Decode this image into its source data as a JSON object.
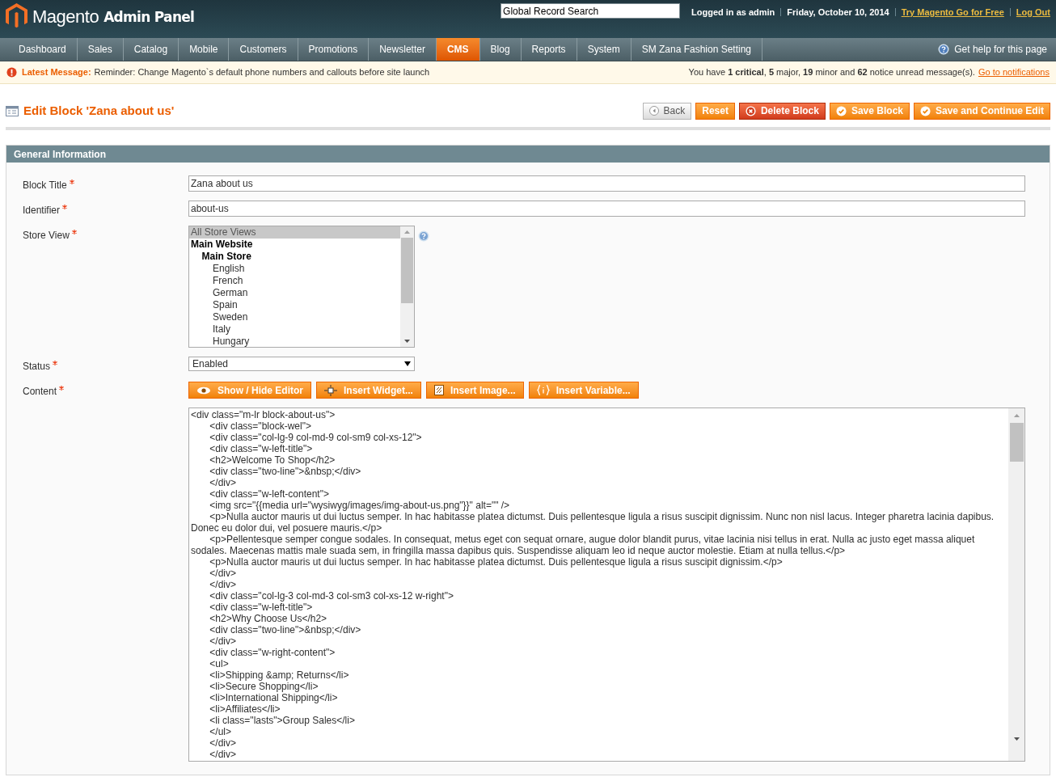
{
  "header": {
    "logo_text": "Magento",
    "logo_sub": "Admin Panel",
    "search": {
      "value": "Global Record Search"
    },
    "logged_in": "Logged in as admin",
    "date": "Friday, October 10, 2014",
    "links": [
      "Try Magento Go for Free",
      "Log Out"
    ]
  },
  "nav": {
    "items": [
      {
        "label": "Dashboard",
        "selected": false
      },
      {
        "label": "Sales",
        "selected": false
      },
      {
        "label": "Catalog",
        "selected": false
      },
      {
        "label": "Mobile",
        "selected": false
      },
      {
        "label": "Customers",
        "selected": false
      },
      {
        "label": "Promotions",
        "selected": false
      },
      {
        "label": "Newsletter",
        "selected": false
      },
      {
        "label": "CMS",
        "selected": true
      },
      {
        "label": "Blog",
        "selected": false
      },
      {
        "label": "Reports",
        "selected": false
      },
      {
        "label": "System",
        "selected": false
      },
      {
        "label": "SM Zana Fashion Setting",
        "selected": false
      }
    ],
    "help": "Get help for this page"
  },
  "message": {
    "label": "Latest Message:",
    "text": "Reminder: Change Magento`s default phone numbers and callouts before site launch",
    "summary": "You have **1 critical**, **5** major, **19** minor and **62** notice unread message(s).",
    "link": "Go to notifications"
  },
  "page": {
    "title": "Edit Block 'Zana about us'",
    "buttons": [
      {
        "label": "Back",
        "kind": "back"
      },
      {
        "label": "Reset",
        "kind": "plain"
      },
      {
        "label": "Delete Block",
        "kind": "delete"
      },
      {
        "label": "Save Block",
        "kind": "save"
      },
      {
        "label": "Save and Continue Edit",
        "kind": "save"
      }
    ]
  },
  "section": {
    "title": "General Information",
    "fields": [
      {
        "kind": "text",
        "label": "Block Title",
        "required": true,
        "value": "Zana about us"
      },
      {
        "kind": "text",
        "label": "Identifier",
        "required": true,
        "value": "about-us"
      },
      {
        "kind": "multiselect",
        "label": "Store View",
        "required": true,
        "options": [
          {
            "label": "All Store Views",
            "selected": true
          },
          {
            "label": "Main Website",
            "selected": false,
            "children": [
              {
                "label": "Main Store",
                "selected": false,
                "children": [
                  {
                    "label": "English",
                    "selected": false
                  },
                  {
                    "label": "French",
                    "selected": false
                  },
                  {
                    "label": "German",
                    "selected": false
                  },
                  {
                    "label": "Spain",
                    "selected": false
                  },
                  {
                    "label": "Sweden",
                    "selected": false
                  },
                  {
                    "label": "Italy",
                    "selected": false
                  },
                  {
                    "label": "Hungary",
                    "selected": false
                  }
                ]
              }
            ]
          }
        ]
      },
      {
        "kind": "select",
        "label": "Status",
        "required": true,
        "value": "Enabled"
      },
      {
        "kind": "editor",
        "label": "Content",
        "required": true,
        "buttons": [
          {
            "label": "Show / Hide Editor",
            "kind": "eye"
          },
          {
            "label": "Insert Widget...",
            "kind": "widget"
          },
          {
            "label": "Insert Image...",
            "kind": "image"
          },
          {
            "label": "Insert Variable...",
            "kind": "variable"
          }
        ],
        "lines": [
          "<div class=\"m-lr block-about-us\">",
          "\t<div class=\"block-wel\">",
          "\t<div class=\"col-lg-9 col-md-9 col-sm9 col-xs-12\">",
          "\t<div class=\"w-left-title\">",
          "\t<h2>Welcome To Shop</h2>",
          "\t<div class=\"two-line\">&nbsp;</div>",
          "\t</div>",
          "\t<div class=\"w-left-content\">",
          "\t<img src=\"{{media url=\"wysiwyg/images/img-about-us.png\"}}\" alt=\"\" />",
          "\t<p>Nulla auctor mauris ut dui luctus semper. In hac habitasse platea dictumst. Duis pellentesque ligula a risus suscipit dignissim. Nunc non nisl lacus. Integer pharetra lacinia dapibus. Donec eu dolor dui, vel posuere mauris.</p>",
          "\t<p>Pellentesque semper congue sodales. In consequat, metus eget con sequat ornare, augue dolor blandit purus, vitae lacinia nisi tellus in erat. Nulla ac justo eget massa aliquet sodales. Maecenas mattis male suada sem, in fringilla massa dapibus quis. Suspendisse aliquam leo id neque auctor molestie. Etiam at nulla tellus.</p>",
          "\t<p>Nulla auctor mauris ut dui luctus semper. In hac habitasse platea dictumst. Duis pellentesque ligula a risus suscipit dignissim.</p>",
          "\t</div>",
          "\t</div>",
          "\t<div class=\"col-lg-3 col-md-3 col-sm3 col-xs-12 w-right\">",
          "\t<div class=\"w-left-title\">",
          "\t<h2>Why Choose Us</h2>",
          "\t<div class=\"two-line\">&nbsp;</div>",
          "\t</div>",
          "\t<div class=\"w-right-content\">",
          "\t<ul>",
          "\t<li>Shipping &amp; Returns</li>",
          "\t<li>Secure Shopping</li>",
          "\t<li>International Shipping</li>",
          "\t<li>Affiliates</li>",
          "\t<li class=\"lasts\">Group Sales</li>",
          "\t</ul>",
          "\t</div>",
          "\t</div>"
        ]
      }
    ]
  }
}
